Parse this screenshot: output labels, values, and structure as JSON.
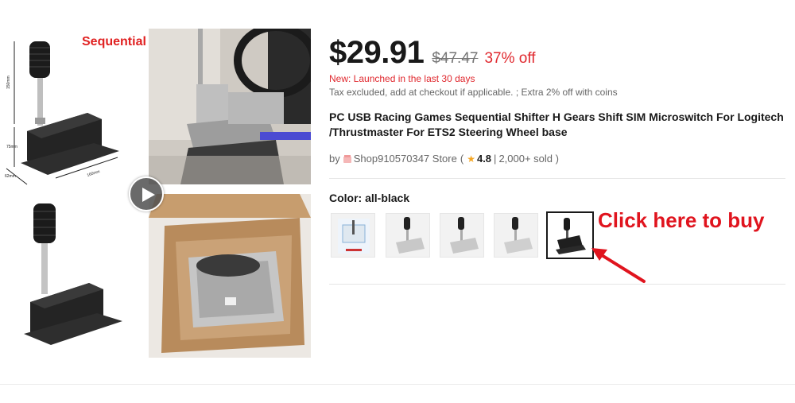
{
  "left_image": {
    "label": "Sequential Shifter",
    "dimensions": [
      "150mm",
      "75mm",
      "62mm",
      "160mm"
    ]
  },
  "media": {
    "play_button_icon": "play-icon",
    "photo_top_alt": "shifter-mounted-photo",
    "photo_bottom_alt": "shifter-in-box-photo"
  },
  "price": {
    "current": "$29.91",
    "original": "$47.47",
    "discount": "37% off"
  },
  "notices": {
    "new_launch": "New: Launched in the last 30 days",
    "tax": "Tax excluded, add at checkout if applicable. ; Extra 2% off with coins"
  },
  "product": {
    "title": "PC USB Racing Games Sequential Shifter H Gears Shift SIM Microswitch For Logitech /Thrustmaster For ETS2 Steering Wheel base"
  },
  "store": {
    "by": "by",
    "name": "Shop910570347 Store",
    "rating": "4.8",
    "sold": "2,000+ sold )",
    "open_paren": "(",
    "sep": "|"
  },
  "options": {
    "color_label": "Color: all-black",
    "swatches": [
      "variant-1",
      "variant-2",
      "variant-3",
      "variant-4",
      "all-black"
    ],
    "selected_index": 4
  },
  "cta": {
    "text": "Click here to buy"
  },
  "colors": {
    "accent_red": "#e0282e",
    "cta_red": "#e0141e",
    "arrow_red": "#e0141e",
    "star": "#f5a623"
  }
}
